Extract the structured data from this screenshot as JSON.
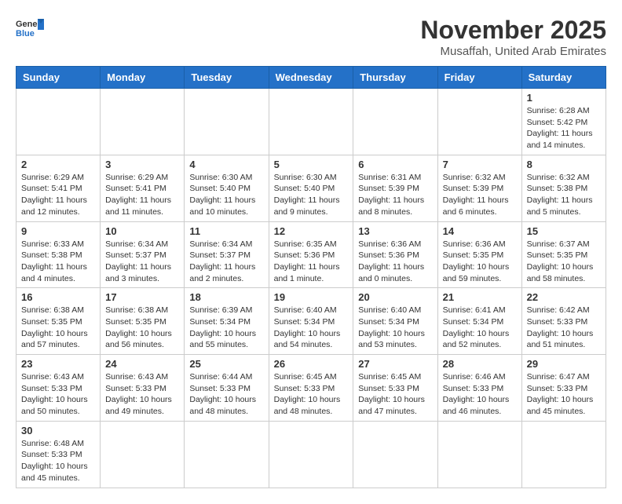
{
  "header": {
    "logo_general": "General",
    "logo_blue": "Blue",
    "month_title": "November 2025",
    "subtitle": "Musaffah, United Arab Emirates"
  },
  "weekdays": [
    "Sunday",
    "Monday",
    "Tuesday",
    "Wednesday",
    "Thursday",
    "Friday",
    "Saturday"
  ],
  "weeks": [
    [
      {
        "day": "",
        "info": ""
      },
      {
        "day": "",
        "info": ""
      },
      {
        "day": "",
        "info": ""
      },
      {
        "day": "",
        "info": ""
      },
      {
        "day": "",
        "info": ""
      },
      {
        "day": "",
        "info": ""
      },
      {
        "day": "1",
        "info": "Sunrise: 6:28 AM\nSunset: 5:42 PM\nDaylight: 11 hours and 14 minutes."
      }
    ],
    [
      {
        "day": "2",
        "info": "Sunrise: 6:29 AM\nSunset: 5:41 PM\nDaylight: 11 hours and 12 minutes."
      },
      {
        "day": "3",
        "info": "Sunrise: 6:29 AM\nSunset: 5:41 PM\nDaylight: 11 hours and 11 minutes."
      },
      {
        "day": "4",
        "info": "Sunrise: 6:30 AM\nSunset: 5:40 PM\nDaylight: 11 hours and 10 minutes."
      },
      {
        "day": "5",
        "info": "Sunrise: 6:30 AM\nSunset: 5:40 PM\nDaylight: 11 hours and 9 minutes."
      },
      {
        "day": "6",
        "info": "Sunrise: 6:31 AM\nSunset: 5:39 PM\nDaylight: 11 hours and 8 minutes."
      },
      {
        "day": "7",
        "info": "Sunrise: 6:32 AM\nSunset: 5:39 PM\nDaylight: 11 hours and 6 minutes."
      },
      {
        "day": "8",
        "info": "Sunrise: 6:32 AM\nSunset: 5:38 PM\nDaylight: 11 hours and 5 minutes."
      }
    ],
    [
      {
        "day": "9",
        "info": "Sunrise: 6:33 AM\nSunset: 5:38 PM\nDaylight: 11 hours and 4 minutes."
      },
      {
        "day": "10",
        "info": "Sunrise: 6:34 AM\nSunset: 5:37 PM\nDaylight: 11 hours and 3 minutes."
      },
      {
        "day": "11",
        "info": "Sunrise: 6:34 AM\nSunset: 5:37 PM\nDaylight: 11 hours and 2 minutes."
      },
      {
        "day": "12",
        "info": "Sunrise: 6:35 AM\nSunset: 5:36 PM\nDaylight: 11 hours and 1 minute."
      },
      {
        "day": "13",
        "info": "Sunrise: 6:36 AM\nSunset: 5:36 PM\nDaylight: 11 hours and 0 minutes."
      },
      {
        "day": "14",
        "info": "Sunrise: 6:36 AM\nSunset: 5:35 PM\nDaylight: 10 hours and 59 minutes."
      },
      {
        "day": "15",
        "info": "Sunrise: 6:37 AM\nSunset: 5:35 PM\nDaylight: 10 hours and 58 minutes."
      }
    ],
    [
      {
        "day": "16",
        "info": "Sunrise: 6:38 AM\nSunset: 5:35 PM\nDaylight: 10 hours and 57 minutes."
      },
      {
        "day": "17",
        "info": "Sunrise: 6:38 AM\nSunset: 5:35 PM\nDaylight: 10 hours and 56 minutes."
      },
      {
        "day": "18",
        "info": "Sunrise: 6:39 AM\nSunset: 5:34 PM\nDaylight: 10 hours and 55 minutes."
      },
      {
        "day": "19",
        "info": "Sunrise: 6:40 AM\nSunset: 5:34 PM\nDaylight: 10 hours and 54 minutes."
      },
      {
        "day": "20",
        "info": "Sunrise: 6:40 AM\nSunset: 5:34 PM\nDaylight: 10 hours and 53 minutes."
      },
      {
        "day": "21",
        "info": "Sunrise: 6:41 AM\nSunset: 5:34 PM\nDaylight: 10 hours and 52 minutes."
      },
      {
        "day": "22",
        "info": "Sunrise: 6:42 AM\nSunset: 5:33 PM\nDaylight: 10 hours and 51 minutes."
      }
    ],
    [
      {
        "day": "23",
        "info": "Sunrise: 6:43 AM\nSunset: 5:33 PM\nDaylight: 10 hours and 50 minutes."
      },
      {
        "day": "24",
        "info": "Sunrise: 6:43 AM\nSunset: 5:33 PM\nDaylight: 10 hours and 49 minutes."
      },
      {
        "day": "25",
        "info": "Sunrise: 6:44 AM\nSunset: 5:33 PM\nDaylight: 10 hours and 48 minutes."
      },
      {
        "day": "26",
        "info": "Sunrise: 6:45 AM\nSunset: 5:33 PM\nDaylight: 10 hours and 48 minutes."
      },
      {
        "day": "27",
        "info": "Sunrise: 6:45 AM\nSunset: 5:33 PM\nDaylight: 10 hours and 47 minutes."
      },
      {
        "day": "28",
        "info": "Sunrise: 6:46 AM\nSunset: 5:33 PM\nDaylight: 10 hours and 46 minutes."
      },
      {
        "day": "29",
        "info": "Sunrise: 6:47 AM\nSunset: 5:33 PM\nDaylight: 10 hours and 45 minutes."
      }
    ],
    [
      {
        "day": "30",
        "info": "Sunrise: 6:48 AM\nSunset: 5:33 PM\nDaylight: 10 hours and 45 minutes."
      },
      {
        "day": "",
        "info": ""
      },
      {
        "day": "",
        "info": ""
      },
      {
        "day": "",
        "info": ""
      },
      {
        "day": "",
        "info": ""
      },
      {
        "day": "",
        "info": ""
      },
      {
        "day": "",
        "info": ""
      }
    ]
  ]
}
